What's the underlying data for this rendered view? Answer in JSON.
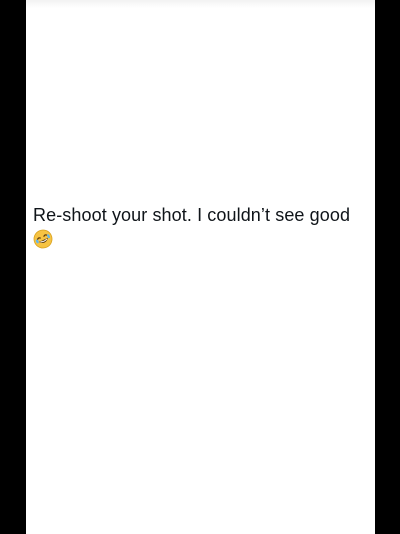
{
  "post": {
    "text": "Re-shoot your shot. I couldn’t see good",
    "emoji": "rolling-on-the-floor-laughing-emoji"
  },
  "colors": {
    "background": "#000000",
    "panel": "#ffffff",
    "text": "#0f1419",
    "emoji_face": "#f6c343"
  }
}
